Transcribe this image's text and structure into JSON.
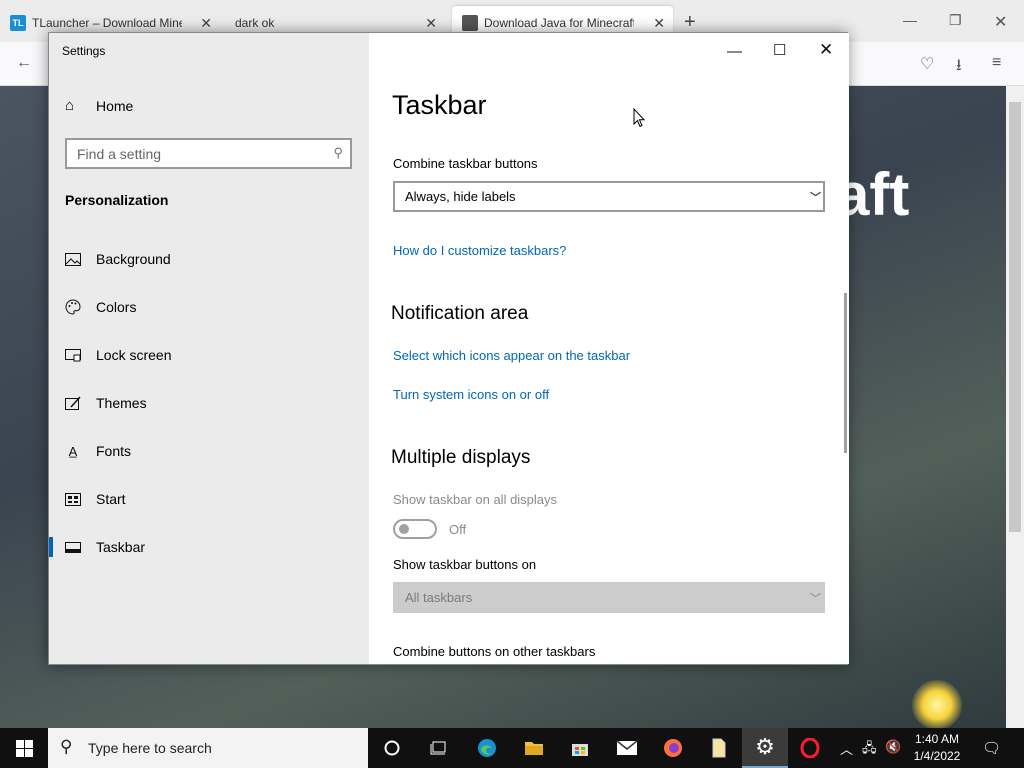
{
  "browser": {
    "tabs": [
      {
        "label": "TLauncher – Download Minecraft",
        "favicon": "TL",
        "favicon_color": "#1a8fd1"
      },
      {
        "label": "dark ok"
      },
      {
        "label": "Download Java for Minecraft (R",
        "favicon_color": "#555555"
      }
    ],
    "hero_text": "aft"
  },
  "settings": {
    "window_title": "Settings",
    "home_label": "Home",
    "search_placeholder": "Find a setting",
    "section_label": "Personalization",
    "nav_items": [
      {
        "label": "Background",
        "icon": "picture-icon"
      },
      {
        "label": "Colors",
        "icon": "palette-icon"
      },
      {
        "label": "Lock screen",
        "icon": "lock-screen-icon"
      },
      {
        "label": "Themes",
        "icon": "themes-icon"
      },
      {
        "label": "Fonts",
        "icon": "fonts-icon"
      },
      {
        "label": "Start",
        "icon": "start-icon"
      },
      {
        "label": "Taskbar",
        "icon": "taskbar-icon",
        "selected": true
      }
    ],
    "content": {
      "heading": "Taskbar",
      "combine_label": "Combine taskbar buttons",
      "combine_value": "Always, hide labels",
      "customize_link": "How do I customize taskbars?",
      "notification_heading": "Notification area",
      "select_icons_link": "Select which icons appear on the taskbar",
      "system_icons_link": "Turn system icons on or off",
      "multiple_displays_heading": "Multiple displays",
      "show_all_label": "Show taskbar on all displays",
      "show_all_state": "Off",
      "show_buttons_label": "Show taskbar buttons on",
      "show_buttons_value": "All taskbars",
      "combine_other_label": "Combine buttons on other taskbars"
    },
    "accent_color": "#0067c0",
    "link_color": "#0067b8"
  },
  "taskbar": {
    "search_placeholder": "Type here to search",
    "time": "1:40 AM",
    "date": "1/4/2022"
  }
}
